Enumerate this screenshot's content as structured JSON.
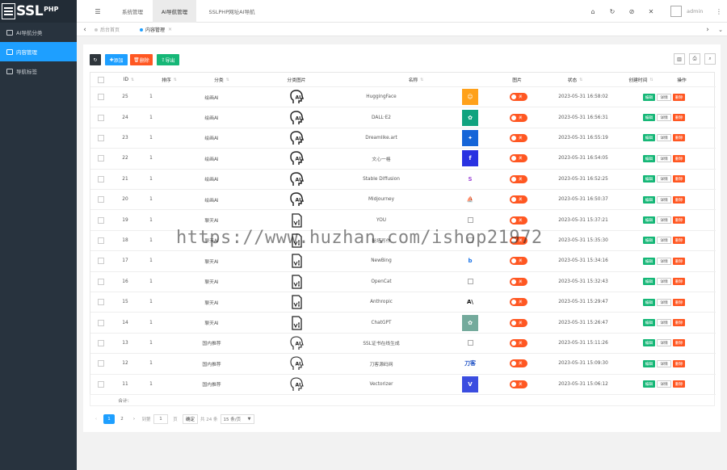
{
  "logo": {
    "text": "SSL",
    "sup": "PHP"
  },
  "sidebar": {
    "items": [
      {
        "label": "AI导航分类",
        "active": false
      },
      {
        "label": "内容管理",
        "active": true
      },
      {
        "label": "导航标签",
        "active": false
      }
    ]
  },
  "topnav": {
    "menu_icon": "menu-icon",
    "items": [
      {
        "label": "系统管理",
        "active": false
      },
      {
        "label": "AI导航管理",
        "active": true
      },
      {
        "label": "SSLPHP网址AI导航",
        "active": false
      }
    ],
    "username": "admin"
  },
  "tabs": [
    {
      "label": "后台首页",
      "active": false
    },
    {
      "label": "内容管理",
      "active": true
    }
  ],
  "toolbar": {
    "add": "添加",
    "delete": "删除",
    "export": "导出"
  },
  "columns": [
    "ID",
    "排序",
    "分类",
    "分类图片",
    "名称",
    "图片",
    "状态",
    "创建时间",
    "操作"
  ],
  "actions": {
    "edit": "编辑",
    "detail": "详情",
    "delete": "删除"
  },
  "switch_label": "关",
  "rows": [
    {
      "id": "25",
      "sort": "1",
      "category": "绘画AI",
      "cat_icon": "ai-head",
      "name": "HuggingFace",
      "pic": {
        "kind": "color",
        "bg": "#ffa11a",
        "glyph": "☺"
      },
      "time": "2023-05-31 16:58:02"
    },
    {
      "id": "24",
      "sort": "1",
      "category": "绘画AI",
      "cat_icon": "ai-head",
      "name": "DALL·E2",
      "pic": {
        "kind": "color",
        "bg": "#10a37f",
        "glyph": "✿"
      },
      "time": "2023-05-31 16:56:31"
    },
    {
      "id": "23",
      "sort": "1",
      "category": "绘画AI",
      "cat_icon": "ai-head",
      "name": "Dreamlike.art",
      "pic": {
        "kind": "color",
        "bg": "#1565d8",
        "glyph": "✦"
      },
      "time": "2023-05-31 16:55:19"
    },
    {
      "id": "22",
      "sort": "1",
      "category": "绘画AI",
      "cat_icon": "ai-head",
      "name": "文心一格",
      "pic": {
        "kind": "color",
        "bg": "#2932e1",
        "glyph": "f"
      },
      "time": "2023-05-31 16:54:05"
    },
    {
      "id": "21",
      "sort": "1",
      "category": "绘画AI",
      "cat_icon": "ai-head",
      "name": "Stable Diffusion",
      "pic": {
        "kind": "color",
        "bg": "#ffffff",
        "glyph": "S",
        "fg": "#a14bd8"
      },
      "time": "2023-05-31 16:52:25"
    },
    {
      "id": "20",
      "sort": "1",
      "category": "绘画AI",
      "cat_icon": "ai-head",
      "name": "Midjourney",
      "pic": {
        "kind": "color",
        "bg": "#ffffff",
        "glyph": "⛵",
        "fg": "#333"
      },
      "time": "2023-05-31 16:50:37"
    },
    {
      "id": "19",
      "sort": "1",
      "category": "聊天AI",
      "cat_icon": "ai-doc",
      "name": "YOU",
      "pic": {
        "kind": "broken"
      },
      "time": "2023-05-31 15:37:21"
    },
    {
      "id": "18",
      "sort": "1",
      "category": "聊天AI",
      "cat_icon": "ai-doc",
      "name": "秘塔写作",
      "pic": {
        "kind": "broken"
      },
      "time": "2023-05-31 15:35:30"
    },
    {
      "id": "17",
      "sort": "1",
      "category": "聊天AI",
      "cat_icon": "ai-doc",
      "name": "NewBing",
      "pic": {
        "kind": "color",
        "bg": "#ffffff",
        "glyph": "b",
        "fg": "#1a73e8"
      },
      "time": "2023-05-31 15:34:16"
    },
    {
      "id": "16",
      "sort": "1",
      "category": "聊天AI",
      "cat_icon": "ai-doc",
      "name": "OpenCat",
      "pic": {
        "kind": "broken"
      },
      "time": "2023-05-31 15:32:43"
    },
    {
      "id": "15",
      "sort": "1",
      "category": "聊天AI",
      "cat_icon": "ai-doc",
      "name": "Anthropic",
      "pic": {
        "kind": "color",
        "bg": "#ffffff",
        "glyph": "A\\",
        "fg": "#111"
      },
      "time": "2023-05-31 15:29:47"
    },
    {
      "id": "14",
      "sort": "1",
      "category": "聊天AI",
      "cat_icon": "ai-doc",
      "name": "ChatGPT",
      "pic": {
        "kind": "color",
        "bg": "#74aa9c",
        "glyph": "✿"
      },
      "time": "2023-05-31 15:26:47"
    },
    {
      "id": "13",
      "sort": "1",
      "category": "国内推荐",
      "cat_icon": "ai-head-outline",
      "name": "SSL证书在线生成",
      "pic": {
        "kind": "broken"
      },
      "time": "2023-05-31 15:11:26"
    },
    {
      "id": "12",
      "sort": "1",
      "category": "国内推荐",
      "cat_icon": "ai-head-outline",
      "name": "刀客源码网",
      "pic": {
        "kind": "color",
        "bg": "#ffffff",
        "glyph": "刀客",
        "fg": "#1b4fc4"
      },
      "time": "2023-05-31 15:09:30"
    },
    {
      "id": "11",
      "sort": "1",
      "category": "国内推荐",
      "cat_icon": "ai-head-outline",
      "name": "Vectorizer",
      "pic": {
        "kind": "color",
        "bg": "#3b4de0",
        "glyph": "V"
      },
      "time": "2023-05-31 15:06:12"
    }
  ],
  "footer": {
    "total_label": "合计:"
  },
  "pager": {
    "prev": "‹",
    "pages": [
      "1",
      "2"
    ],
    "next": "›",
    "goto_label": "到第",
    "goto_value": "1",
    "page_unit": "页",
    "confirm": "确定",
    "total": "共 24 条",
    "per_page": "15 条/页"
  },
  "watermark": "https://www.huzhan.com/ishop21972"
}
